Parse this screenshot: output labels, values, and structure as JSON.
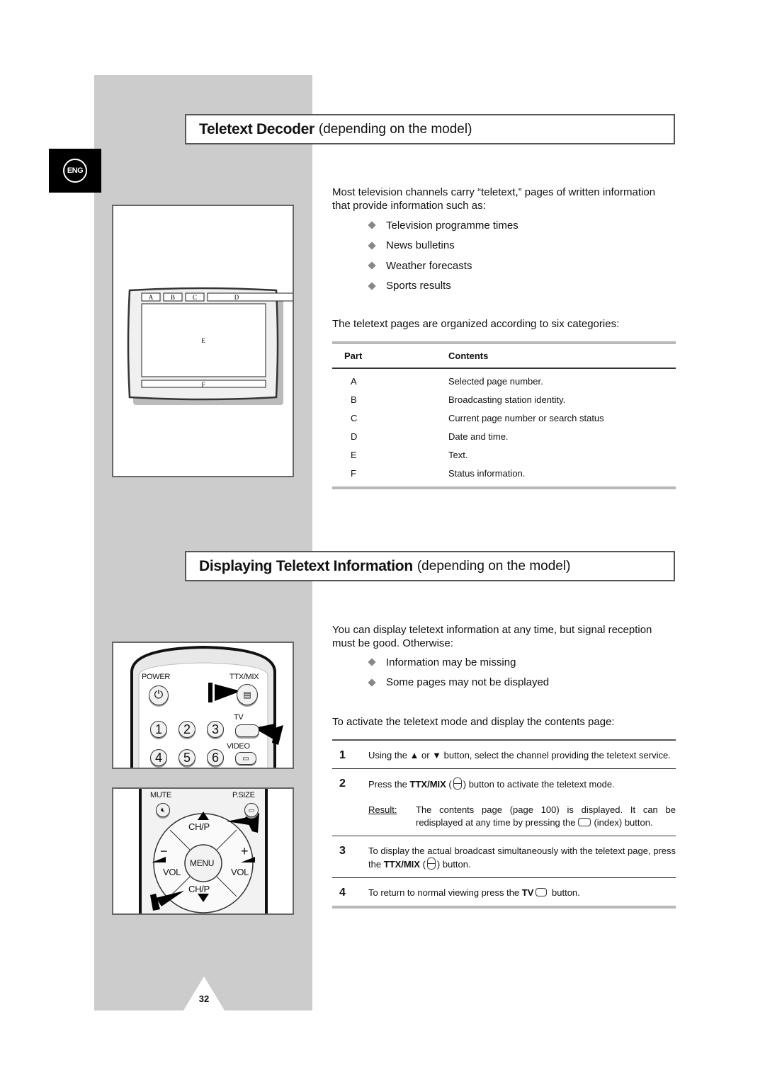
{
  "sidebar": {
    "language_badge": "ENG"
  },
  "section1": {
    "title_bold": "Teletext Decoder",
    "title_sub": "(depending on the model)",
    "intro": "Most television channels carry “teletext,” pages of written information that provide information such as:",
    "bullets": [
      "Television programme times",
      "News bulletins",
      "Weather forecasts",
      "Sports results"
    ],
    "categories_intro": "The teletext pages are organized according to six categories:",
    "table": {
      "headers": [
        "Part",
        "Contents"
      ],
      "rows": [
        {
          "part": "A",
          "contents": "Selected page number."
        },
        {
          "part": "B",
          "contents": "Broadcasting station identity."
        },
        {
          "part": "C",
          "contents": "Current page number or search status"
        },
        {
          "part": "D",
          "contents": "Date and time."
        },
        {
          "part": "E",
          "contents": "Text."
        },
        {
          "part": "F",
          "contents": "Status information."
        }
      ]
    },
    "diagram": {
      "labels": [
        "A",
        "B",
        "C",
        "D",
        "E",
        "F"
      ]
    }
  },
  "section2": {
    "title_bold": "Displaying Teletext Information",
    "title_sub": "(depending on the model)",
    "intro": "You can display teletext information at any time, but signal reception must be good. Otherwise:",
    "bullets": [
      "Information may be missing",
      "Some pages may not be displayed"
    ],
    "activate_intro": "To activate the teletext mode and display the contents page:",
    "steps": [
      {
        "num": "1",
        "text": "Using the ▲ or ▼ button, select the channel providing the teletext service."
      },
      {
        "num": "2",
        "text_pre": "Press the ",
        "bold": "TTX/MIX",
        "text_mid": " (",
        "text_post": ") button to activate the teletext mode.",
        "result_label": "Result:",
        "result_pre": "The contents page (page 100) is displayed. It can be redisplayed at any time by pressing the",
        "result_post": "(index) button."
      },
      {
        "num": "3",
        "text_pre": "To display the actual broadcast simultaneously with the teletext page, press the ",
        "bold": "TTX/MIX",
        "text_mid": " (",
        "text_post": ") button."
      },
      {
        "num": "4",
        "text_pre": "To return to normal viewing press the ",
        "bold": "TV",
        "text_post": " button."
      }
    ],
    "remote_top": {
      "power": "POWER",
      "ttx": "TTX/MIX",
      "tv": "TV",
      "video": "VIDEO",
      "digits": [
        "1",
        "2",
        "3",
        "4",
        "5",
        "6"
      ]
    },
    "remote_bottom": {
      "mute": "MUTE",
      "psize": "P.SIZE",
      "chp_up": "CH/P",
      "chp_down": "CH/P",
      "menu": "MENU",
      "vol_minus": "VOL",
      "vol_plus": "VOL",
      "minus": "−",
      "plus": "+"
    }
  },
  "footer": {
    "page_number": "32"
  }
}
